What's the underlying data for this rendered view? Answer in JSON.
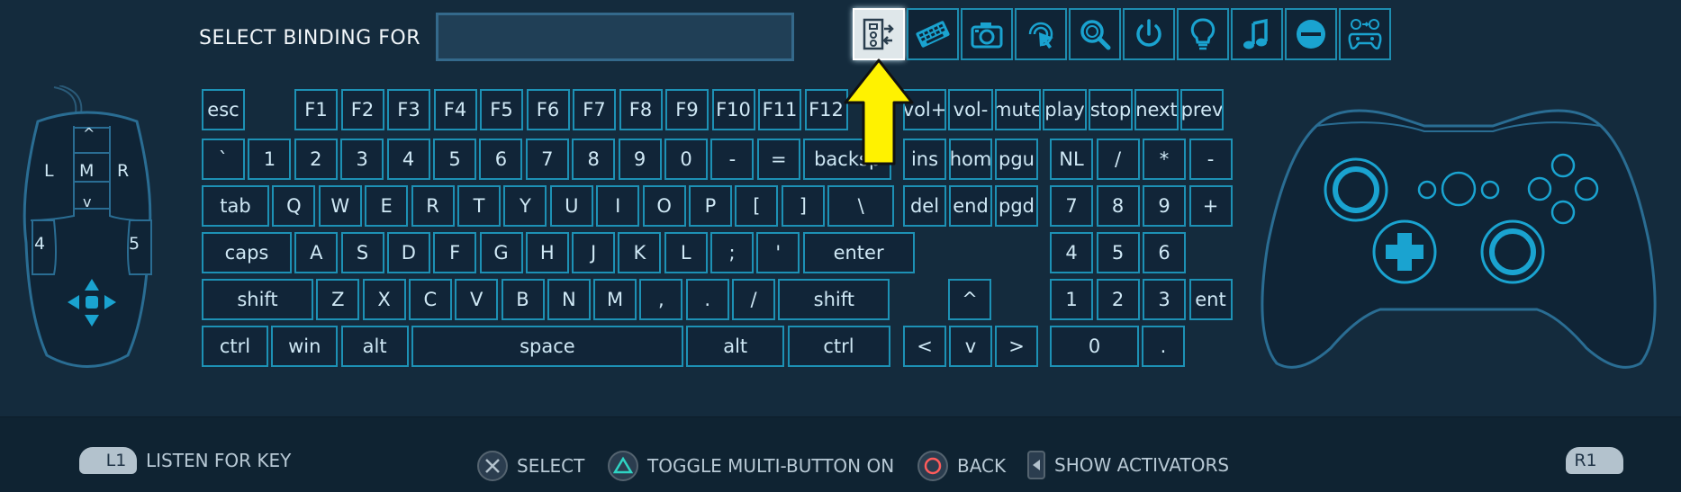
{
  "header": {
    "title": "SELECT BINDING FOR",
    "binding_value": ""
  },
  "mode_buttons": [
    {
      "icon": "action-set-icon",
      "active": true
    },
    {
      "icon": "keyboard-icon",
      "active": false
    },
    {
      "icon": "camera-icon",
      "active": false
    },
    {
      "icon": "mouse-click-icon",
      "active": false
    },
    {
      "icon": "magnifier-icon",
      "active": false
    },
    {
      "icon": "power-icon",
      "active": false
    },
    {
      "icon": "lightbulb-icon",
      "active": false
    },
    {
      "icon": "music-note-icon",
      "active": false
    },
    {
      "icon": "none-icon",
      "active": false
    },
    {
      "icon": "controller-swap-icon",
      "active": false
    }
  ],
  "mouse": {
    "left": "L",
    "middle": "M",
    "right": "R",
    "side_back": "4",
    "side_forward": "5",
    "scroll_up": "^",
    "scroll_down": "v"
  },
  "keyboard": {
    "esc": "esc",
    "function_row": [
      "F1",
      "F2",
      "F3",
      "F4",
      "F5",
      "F6",
      "F7",
      "F8",
      "F9",
      "F10",
      "F11",
      "F12"
    ],
    "media_row": [
      "vol+",
      "vol-",
      "mute",
      "play",
      "stop",
      "next",
      "prev"
    ],
    "number_row": [
      "`",
      "1",
      "2",
      "3",
      "4",
      "5",
      "6",
      "7",
      "8",
      "9",
      "0",
      "-",
      "=",
      "backsp"
    ],
    "nav_row1": [
      "ins",
      "hom",
      "pgu"
    ],
    "numpad_row1": [
      "NL",
      "/",
      "*",
      "-"
    ],
    "qwerty_row": [
      "tab",
      "Q",
      "W",
      "E",
      "R",
      "T",
      "Y",
      "U",
      "I",
      "O",
      "P",
      "[",
      "]",
      "\\"
    ],
    "nav_row2": [
      "del",
      "end",
      "pgd"
    ],
    "numpad_row2": [
      "7",
      "8",
      "9",
      "+"
    ],
    "home_row": [
      "caps",
      "A",
      "S",
      "D",
      "F",
      "G",
      "H",
      "J",
      "K",
      "L",
      ";",
      "'",
      "enter"
    ],
    "numpad_row3": [
      "4",
      "5",
      "6"
    ],
    "shift_row": [
      "shift",
      "Z",
      "X",
      "C",
      "V",
      "B",
      "N",
      "M",
      ",",
      ".",
      "/",
      "shift"
    ],
    "arrow_up": "^",
    "numpad_row4": [
      "1",
      "2",
      "3",
      "ent"
    ],
    "bottom_row": [
      "ctrl",
      "win",
      "alt",
      "space",
      "alt",
      "ctrl"
    ],
    "arrows": [
      "<",
      "v",
      ">"
    ],
    "numpad_row5": [
      "0",
      "."
    ]
  },
  "footer": {
    "l1_badge": "L1",
    "l1_label": "LISTEN FOR KEY",
    "select_label": "SELECT",
    "toggle_label": "TOGGLE MULTI-BUTTON ON",
    "back_label": "BACK",
    "activators_label": "SHOW ACTIVATORS",
    "r1_badge": "R1"
  },
  "colors": {
    "background": "#142b3d",
    "key_border": "#1d91b5",
    "key_fill": "#112538",
    "accent_yellow": "#fff200",
    "text": "#cfe8f5"
  }
}
